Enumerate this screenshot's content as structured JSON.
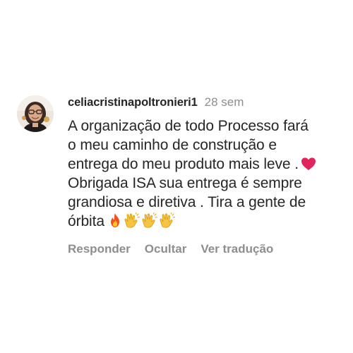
{
  "comment": {
    "username": "celiacristinapoltronieri1",
    "timestamp": "28 sem",
    "text_lines": [
      "A organização de todo Processo fará",
      "o meu caminho de construção e",
      "entrega do meu produto mais leve .",
      "Obrigada ISA sua entrega é sempre",
      "grandiosa e diretiva . Tira a gente de",
      "órbita"
    ],
    "emojis": {
      "line3": "red-heart",
      "line6": [
        "fire",
        "clapping-hands",
        "clapping-hands",
        "clapping-hands"
      ]
    },
    "actions": {
      "reply": "Responder",
      "hide": "Ocultar",
      "translate": "Ver tradução"
    }
  },
  "colors": {
    "text": "#262626",
    "secondary": "#8e8e8e",
    "heart": "#e0245e",
    "background": "#ffffff"
  }
}
